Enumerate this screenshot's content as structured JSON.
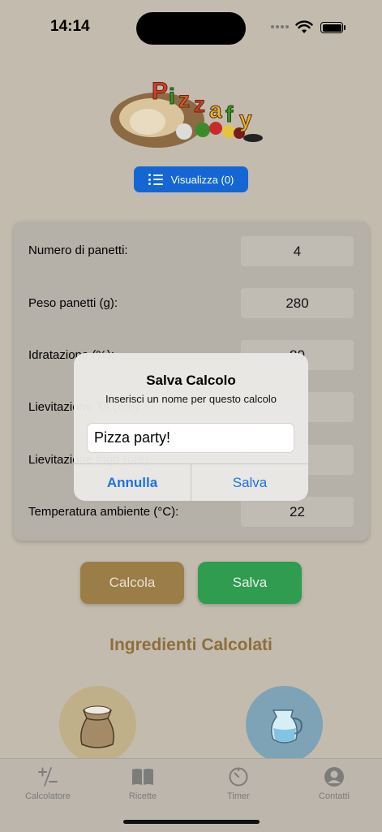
{
  "status": {
    "time": "14:14"
  },
  "header": {
    "view_button_label": "Visualizza (0)"
  },
  "form": {
    "rows": [
      {
        "label": "Numero di panetti:",
        "value": "4"
      },
      {
        "label": "Peso panetti (g):",
        "value": "280"
      },
      {
        "label": "Idratazione (%):",
        "value": "80"
      },
      {
        "label": "Lievitazione TA (ore):",
        "value": ""
      },
      {
        "label": "Lievitazione frigo (ore):",
        "value": ""
      },
      {
        "label": "Temperatura ambiente (°C):",
        "value": "22"
      }
    ]
  },
  "actions": {
    "calculate_label": "Calcola",
    "save_label": "Salva"
  },
  "ingredients": {
    "title": "Ingredienti Calcolati"
  },
  "alert": {
    "title": "Salva Calcolo",
    "message": "Inserisci un nome per questo calcolo",
    "input_value": "Pizza party!",
    "cancel_label": "Annulla",
    "save_label": "Salva"
  },
  "tabs": [
    {
      "label": "Calcolatore",
      "icon": "plus-minus-icon"
    },
    {
      "label": "Ricette",
      "icon": "book-icon"
    },
    {
      "label": "Timer",
      "icon": "timer-icon"
    },
    {
      "label": "Contatti",
      "icon": "person-circle-icon"
    }
  ],
  "colors": {
    "background": "#c3bbae",
    "accent_blue": "#1466d4",
    "calcola": "#9b7d47",
    "salva": "#2f9c4f",
    "title_brown": "#8f6d3c"
  }
}
